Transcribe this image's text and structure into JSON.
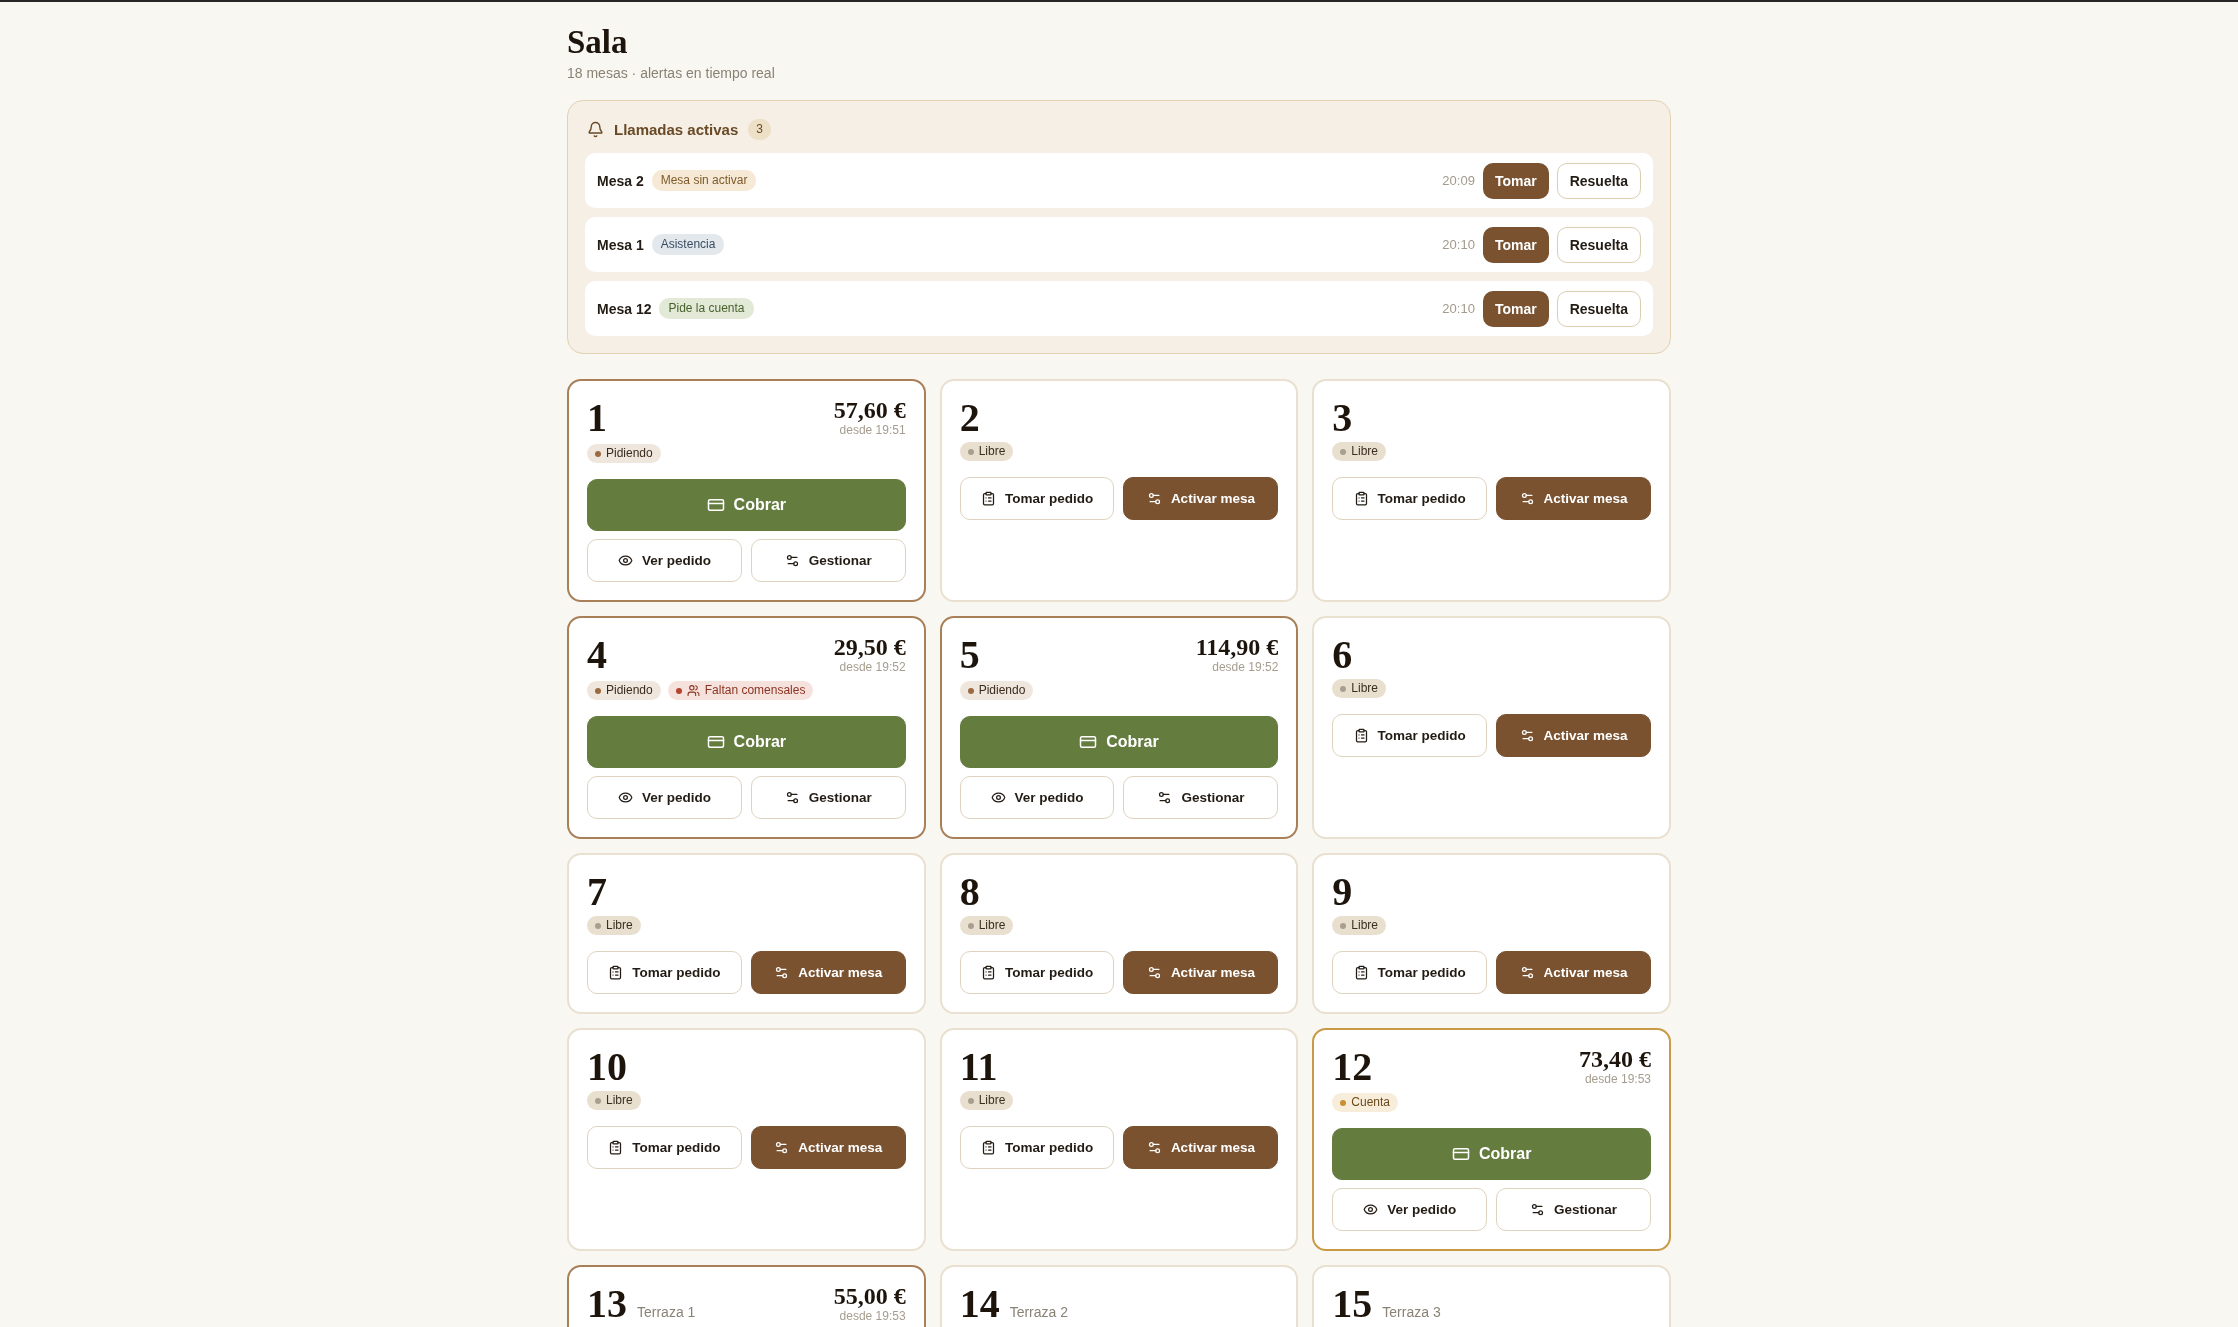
{
  "header": {
    "title": "Sala",
    "subtitle": "18 mesas · alertas en tiempo real"
  },
  "calls": {
    "title": "Llamadas activas",
    "count": "3",
    "items": [
      {
        "table": "Mesa 2",
        "reason": "Mesa sin activar",
        "kind": "activation",
        "time": "20:09",
        "take": "Tomar",
        "resolve": "Resuelta"
      },
      {
        "table": "Mesa 1",
        "reason": "Asistencia",
        "kind": "assistance",
        "time": "20:10",
        "take": "Tomar",
        "resolve": "Resuelta"
      },
      {
        "table": "Mesa 12",
        "reason": "Pide la cuenta",
        "kind": "bill",
        "time": "20:10",
        "take": "Tomar",
        "resolve": "Resuelta"
      }
    ]
  },
  "tables": [
    {
      "number": "1",
      "kind": "ordering",
      "total": "57,60 €",
      "since": "desde 19:51",
      "badges": [
        {
          "label": "Pidiendo",
          "kind": "ordering",
          "color": "#9a6a43"
        }
      ],
      "actions": [
        {
          "label": "Cobrar",
          "kind": "pay"
        },
        {
          "label": "Ver pedido",
          "kind": "view"
        },
        {
          "label": "Gestionar",
          "kind": "manage"
        }
      ]
    },
    {
      "number": "2",
      "kind": "free",
      "badges": [
        {
          "label": "Libre",
          "kind": "free",
          "color": "#a89f90"
        }
      ],
      "actions": [
        {
          "label": "Tomar pedido",
          "kind": "order"
        },
        {
          "label": "Activar mesa",
          "kind": "activate"
        }
      ]
    },
    {
      "number": "3",
      "kind": "free",
      "badges": [
        {
          "label": "Libre",
          "kind": "free",
          "color": "#a89f90"
        }
      ],
      "actions": [
        {
          "label": "Tomar pedido",
          "kind": "order"
        },
        {
          "label": "Activar mesa",
          "kind": "activate"
        }
      ]
    },
    {
      "number": "4",
      "kind": "ordering",
      "total": "29,50 €",
      "since": "desde 19:52",
      "badges": [
        {
          "label": "Pidiendo",
          "kind": "ordering",
          "color": "#9a6a43"
        },
        {
          "label": "Faltan comensales",
          "kind": "alert",
          "color": "#b4452e"
        }
      ],
      "actions": [
        {
          "label": "Cobrar",
          "kind": "pay"
        },
        {
          "label": "Ver pedido",
          "kind": "view"
        },
        {
          "label": "Gestionar",
          "kind": "manage"
        }
      ]
    },
    {
      "number": "5",
      "kind": "ordering",
      "total": "114,90 €",
      "since": "desde 19:52",
      "badges": [
        {
          "label": "Pidiendo",
          "kind": "ordering",
          "color": "#9a6a43"
        }
      ],
      "actions": [
        {
          "label": "Cobrar",
          "kind": "pay"
        },
        {
          "label": "Ver pedido",
          "kind": "view"
        },
        {
          "label": "Gestionar",
          "kind": "manage"
        }
      ]
    },
    {
      "number": "6",
      "kind": "free",
      "badges": [
        {
          "label": "Libre",
          "kind": "free",
          "color": "#a89f90"
        }
      ],
      "actions": [
        {
          "label": "Tomar pedido",
          "kind": "order"
        },
        {
          "label": "Activar mesa",
          "kind": "activate"
        }
      ]
    },
    {
      "number": "7",
      "kind": "free",
      "badges": [
        {
          "label": "Libre",
          "kind": "free",
          "color": "#a89f90"
        }
      ],
      "actions": [
        {
          "label": "Tomar pedido",
          "kind": "order"
        },
        {
          "label": "Activar mesa",
          "kind": "activate"
        }
      ]
    },
    {
      "number": "8",
      "kind": "free",
      "badges": [
        {
          "label": "Libre",
          "kind": "free",
          "color": "#a89f90"
        }
      ],
      "actions": [
        {
          "label": "Tomar pedido",
          "kind": "order"
        },
        {
          "label": "Activar mesa",
          "kind": "activate"
        }
      ]
    },
    {
      "number": "9",
      "kind": "free",
      "badges": [
        {
          "label": "Libre",
          "kind": "free",
          "color": "#a89f90"
        }
      ],
      "actions": [
        {
          "label": "Tomar pedido",
          "kind": "order"
        },
        {
          "label": "Activar mesa",
          "kind": "activate"
        }
      ]
    },
    {
      "number": "10",
      "kind": "free",
      "badges": [
        {
          "label": "Libre",
          "kind": "free",
          "color": "#a89f90"
        }
      ],
      "actions": [
        {
          "label": "Tomar pedido",
          "kind": "order"
        },
        {
          "label": "Activar mesa",
          "kind": "activate"
        }
      ]
    },
    {
      "number": "11",
      "kind": "free",
      "badges": [
        {
          "label": "Libre",
          "kind": "free",
          "color": "#a89f90"
        }
      ],
      "actions": [
        {
          "label": "Tomar pedido",
          "kind": "order"
        },
        {
          "label": "Activar mesa",
          "kind": "activate"
        }
      ]
    },
    {
      "number": "12",
      "kind": "bill",
      "total": "73,40 €",
      "since": "desde 19:53",
      "badges": [
        {
          "label": "Cuenta",
          "kind": "bill",
          "color": "#c98f33"
        }
      ],
      "actions": [
        {
          "label": "Cobrar",
          "kind": "pay"
        },
        {
          "label": "Ver pedido",
          "kind": "view"
        },
        {
          "label": "Gestionar",
          "kind": "manage"
        }
      ]
    },
    {
      "number": "13",
      "zone": "Terraza 1",
      "kind": "ordering",
      "total": "55,00 €",
      "since": "desde 19:53"
    },
    {
      "number": "14",
      "zone": "Terraza 2",
      "kind": "free"
    },
    {
      "number": "15",
      "zone": "Terraza 3",
      "kind": "free"
    }
  ]
}
